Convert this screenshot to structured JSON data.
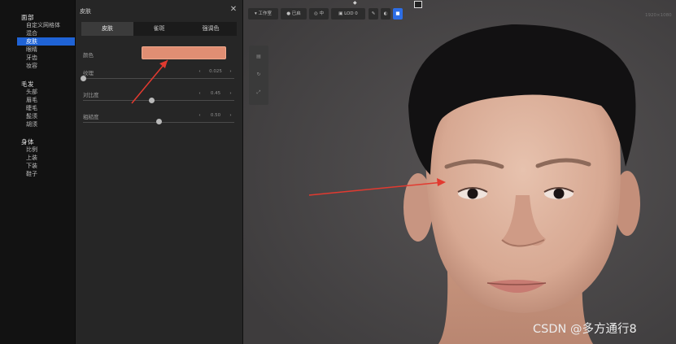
{
  "nav": {
    "groups": [
      {
        "title": "面部",
        "items": [
          "自定义网格体",
          "混合",
          "皮肤",
          "眼睛",
          "牙齿",
          "妆容"
        ]
      },
      {
        "title": "毛发",
        "items": [
          "头部",
          "眉毛",
          "睫毛",
          "髭须",
          "胡须"
        ]
      },
      {
        "title": "身体",
        "items": [
          "比例",
          "上装",
          "下装",
          "鞋子"
        ]
      }
    ],
    "selected": "皮肤"
  },
  "panel": {
    "title": "皮肤",
    "close_icon": "close-icon",
    "tabs": [
      "皮肤",
      "雀斑",
      "强调色"
    ],
    "active_tab": "皮肤",
    "color_label": "颜色",
    "color_value": "#e08e73",
    "sliders": [
      {
        "label": "纹理",
        "value": "0.025",
        "level": 0.0
      },
      {
        "label": "对比度",
        "value": "0.45",
        "level": 0.45
      },
      {
        "label": "粗糙度",
        "value": "0.50",
        "level": 0.5
      }
    ]
  },
  "viewport": {
    "toolbar": [
      "工作室",
      "已启",
      "中",
      "LOD 0"
    ],
    "toolbar_icons": [
      "camera-icon",
      "light-icon",
      "grid-icon",
      "globe-icon",
      "video-icon"
    ],
    "corner_text": "1920×1080",
    "watermark": "CSDN @多方通行8",
    "background": "#474546"
  }
}
